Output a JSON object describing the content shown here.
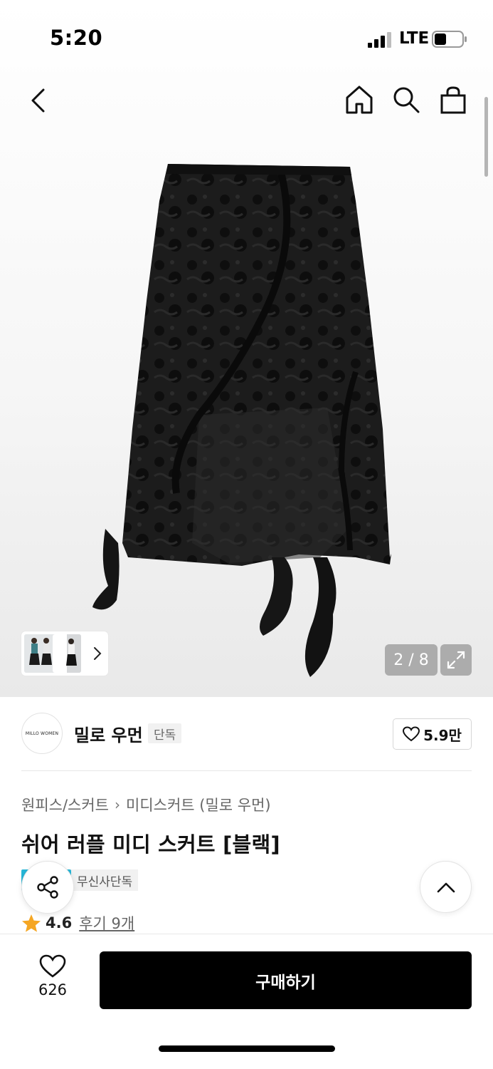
{
  "status_bar": {
    "time": "5:20",
    "network": "LTE"
  },
  "nav": {
    "icons": [
      "back-icon",
      "home-icon",
      "search-icon",
      "shopping-bag-icon"
    ]
  },
  "gallery": {
    "page": "2 / 8",
    "current": 2,
    "total": 8
  },
  "brand": {
    "logo_text": "MILLO WOMEN",
    "name": "밀로 우먼",
    "exclusive_tag": "단독",
    "likes": "5.9만"
  },
  "breadcrumb": {
    "category": "원피스/스커트",
    "subcategory": "미디스커트 (밀로 우먼)"
  },
  "product": {
    "title": "쉬어 러플 미디 스커트 [블랙]",
    "tag": "무신사단독",
    "rating": "4.6",
    "reviews": "후기 9개"
  },
  "bottom": {
    "like_count": "626",
    "buy_label": "구매하기"
  },
  "colors": {
    "accent_teal": "#27b7d8",
    "star": "#f5a623",
    "button_black": "#000000"
  }
}
